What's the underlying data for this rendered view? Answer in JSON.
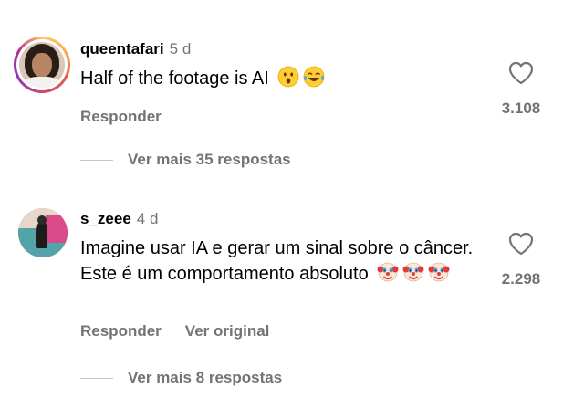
{
  "comments": [
    {
      "username": "queentafari",
      "time": "5 d",
      "text": "Half of the footage is AI",
      "emojis": [
        "hushed-face-emoji",
        "tears-of-joy-emoji"
      ],
      "reply_label": "Responder",
      "like_count": "3.108",
      "view_replies": "Ver mais 35 respostas"
    },
    {
      "username": "s_zeee",
      "time": "4 d",
      "text": "Imagine usar IA e gerar um sinal sobre o câncer. Este é um comportamento absoluto",
      "emojis": [
        "clown-face-emoji",
        "clown-face-emoji",
        "clown-face-emoji"
      ],
      "reply_label": "Responder",
      "translate_label": "Ver original",
      "like_count": "2.298",
      "view_replies": "Ver mais 8 respostas"
    }
  ],
  "icons": {
    "like": "heart-icon"
  },
  "colors": {
    "secondary_text": "#737373",
    "primary_text": "#000000",
    "background": "#ffffff"
  }
}
